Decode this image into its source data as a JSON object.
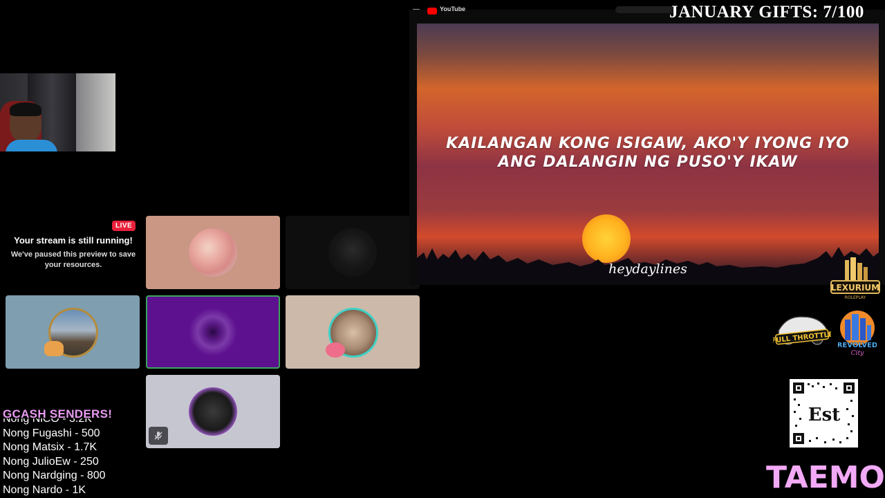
{
  "webcam": {},
  "preview": {
    "live_label": "LIVE",
    "title": "Your stream is still running!",
    "subtitle": "We've paused this preview to save your resources."
  },
  "tiles": [
    {
      "id": "participant-1"
    },
    {
      "id": "participant-2"
    },
    {
      "id": "participant-3"
    },
    {
      "id": "participant-4-speaking"
    },
    {
      "id": "participant-5"
    },
    {
      "id": "participant-6-muted"
    }
  ],
  "gcash": {
    "title": "GCASH SENDERS!",
    "senders": [
      "Nong NiCO - 3.2K",
      "Nong Fugashi - 500",
      "Nong Matsix - 1.7K",
      "Nong JulioEw - 250",
      "Nong Nardging - 800",
      "Nong Nardo - 1K"
    ]
  },
  "player": {
    "site_label": "YouTube",
    "lyric_line_1": "KAILANGAN KONG ISIGAW, AKO'Y IYONG IYO",
    "lyric_line_2": "ANG DALANGIN NG PUSO'Y IKAW",
    "watermark": "heydaylines"
  },
  "overlay": {
    "gifts": "JANUARY GIFTS: 7/100",
    "brand": "TAEMON",
    "logos": {
      "lexurium": "LEXURIUM",
      "lexurium_sub": "ROLEPLAY",
      "full_throttle": "FULL THROTTLE",
      "revolved": "REVOLVED",
      "revolved_sub": "City",
      "qr_label": "Est"
    }
  },
  "colors": {
    "live_red": "#e8203a",
    "speaking_green": "#3ba55c",
    "gcash_pink": "#e89cf0",
    "brand_pink": "#f2a9f6"
  }
}
